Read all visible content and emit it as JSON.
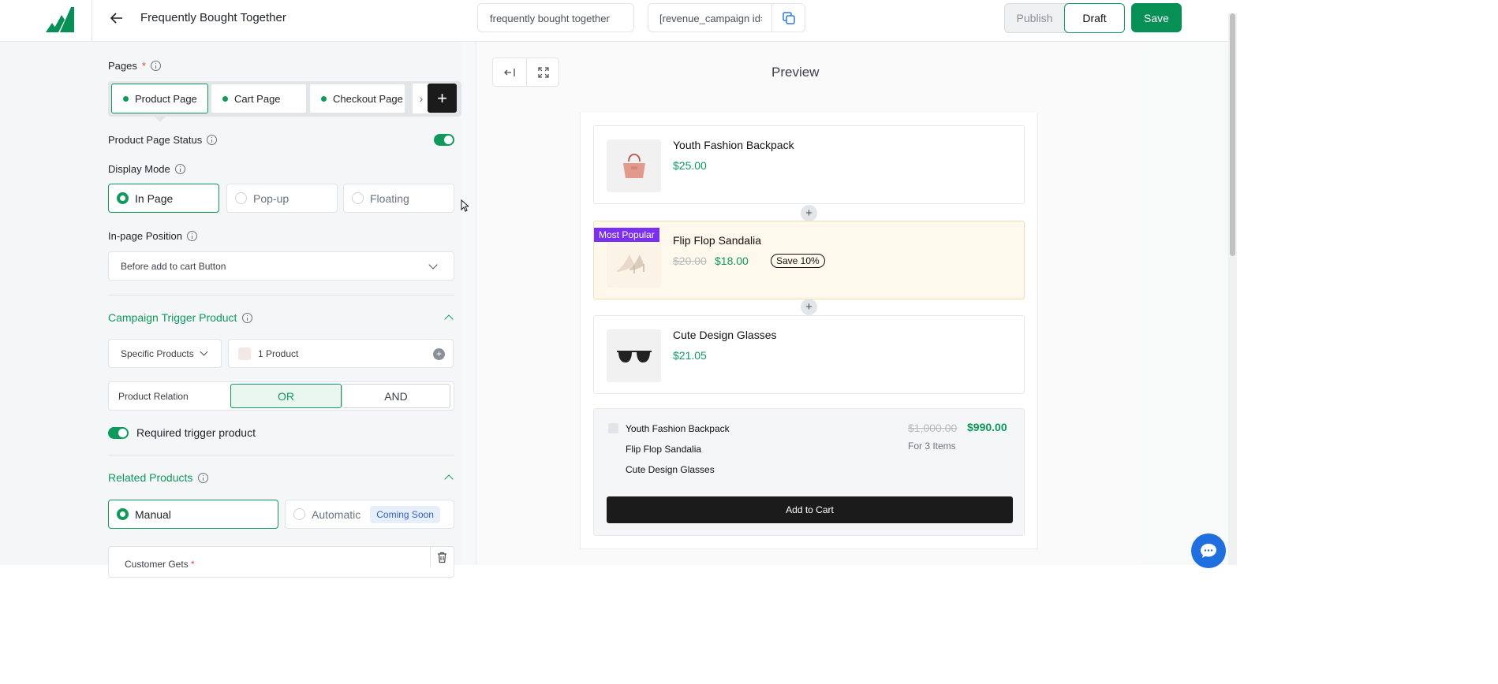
{
  "header": {
    "title": "Frequently Bought Together",
    "slug": "frequently bought together",
    "shortcode": "[revenue_campaign id='",
    "publish_label": "Publish",
    "draft_label": "Draft",
    "save_label": "Save"
  },
  "settings": {
    "pages_label": "Pages",
    "pages_required": "*",
    "pages": [
      {
        "label": "Product Page",
        "active": true
      },
      {
        "label": "Cart Page",
        "active": false
      },
      {
        "label": "Checkout Page",
        "active": false
      }
    ],
    "page_status_label": "Product Page Status",
    "display_mode_label": "Display Mode",
    "display_modes": [
      {
        "label": "In Page",
        "selected": true
      },
      {
        "label": "Pop-up",
        "selected": false
      },
      {
        "label": "Floating",
        "selected": false
      }
    ],
    "position_label": "In-page Position",
    "position_value": "Before add to cart Button",
    "trigger_section_title": "Campaign Trigger Product",
    "trigger_type": "Specific Products",
    "trigger_products": "1 Product",
    "relation_label": "Product Relation",
    "relation_or": "OR",
    "relation_and": "AND",
    "required_trigger_label": "Required trigger product",
    "related_section_title": "Related Products",
    "related_manual": "Manual",
    "related_automatic": "Automatic",
    "coming_soon": "Coming Soon",
    "customer_gets_label": "Customer Gets",
    "customer_gets_required": "*"
  },
  "preview": {
    "title": "Preview",
    "products": [
      {
        "name": "Youth Fashion Backpack",
        "price": "$25.00"
      },
      {
        "name": "Flip Flop Sandalia",
        "badge": "Most Popular",
        "old_price": "$20.00",
        "price": "$18.00",
        "save": "Save 10%"
      },
      {
        "name": "Cute Design Glasses",
        "price": "$21.05"
      }
    ],
    "summary": {
      "items": [
        "Youth Fashion Backpack",
        "Flip Flop Sandalia",
        "Cute Design Glasses"
      ],
      "old_total": "$1,000.00",
      "total": "$990.00",
      "count": "For 3 Items",
      "cta": "Add to Cart"
    }
  },
  "colors": {
    "accent": "#0d9a5b",
    "badge": "#7b2ff2",
    "dark": "#1b1b1b",
    "highlight_bg": "#fff8ec"
  }
}
